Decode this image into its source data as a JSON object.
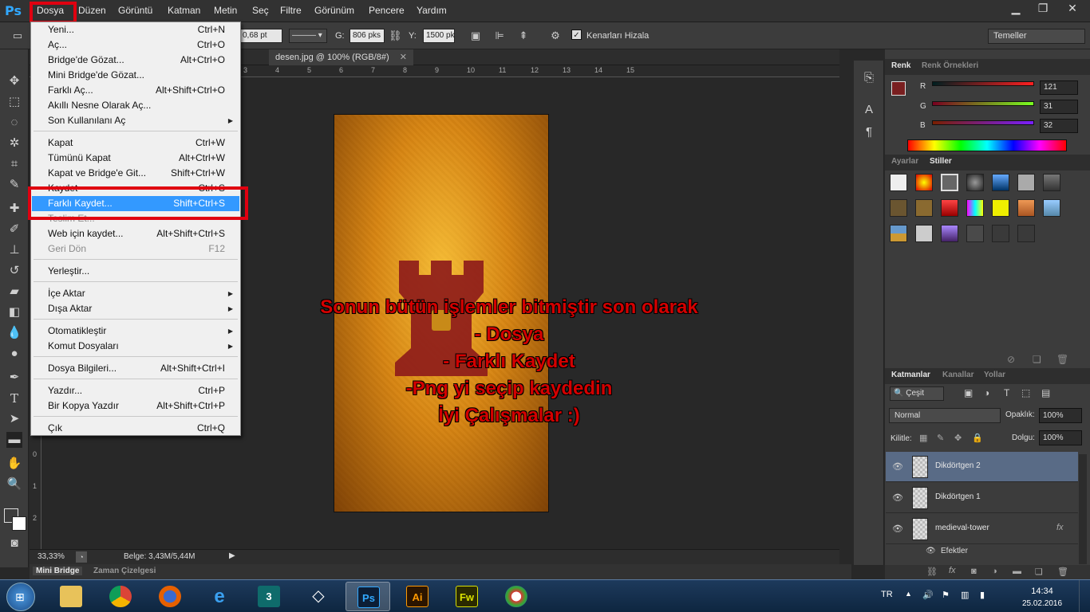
{
  "menubar": {
    "items": [
      "Dosya",
      "Düzen",
      "Görüntü",
      "Katman",
      "Metin",
      "Seç",
      "Filtre",
      "Görünüm",
      "Pencere",
      "Yardım"
    ],
    "logo": "Ps"
  },
  "options": {
    "stroke_size": "0,68 pt",
    "width_label": "G:",
    "width_value": "806 pks",
    "height_label": "Y:",
    "height_value": "1500 pk",
    "align_edges_label": "Kenarları Hizala",
    "align_edges_checked": true,
    "workspace": "Temeller"
  },
  "document": {
    "tab_title": "desen.jpg @ 100% (RGB/8#)",
    "zoom": "33,33%",
    "doc_info": "Belge: 3,43M/5,44M",
    "ruler_h_numbers": [
      "3",
      "4",
      "5",
      "6",
      "7",
      "8",
      "9",
      "10",
      "11",
      "12",
      "13",
      "14",
      "15"
    ],
    "ruler_v_numbers": [
      "0",
      "1",
      "2"
    ]
  },
  "annotation": {
    "lines": [
      "Sonun bütün işlemler bitmiştir son olarak",
      "- Dosya",
      "- Farklı Kaydet",
      "-Png yi seçip kaydedin",
      "İyi Çalışmalar :)"
    ],
    "color": "#d40000"
  },
  "dosya_menu": {
    "items": [
      {
        "label": "Yeni...",
        "shortcut": "Ctrl+N"
      },
      {
        "label": "Aç...",
        "shortcut": "Ctrl+O"
      },
      {
        "label": "Bridge'de Gözat...",
        "shortcut": "Alt+Ctrl+O"
      },
      {
        "label": "Mini Bridge'de Gözat...",
        "shortcut": ""
      },
      {
        "label": "Farklı Aç...",
        "shortcut": "Alt+Shift+Ctrl+O"
      },
      {
        "label": "Akıllı Nesne Olarak Aç...",
        "shortcut": ""
      },
      {
        "label": "Son Kullanılanı Aç",
        "shortcut": ""
      },
      {
        "label": "Kapat",
        "shortcut": "Ctrl+W"
      },
      {
        "label": "Tümünü Kapat",
        "shortcut": "Alt+Ctrl+W"
      },
      {
        "label": "Kapat ve Bridge'e Git...",
        "shortcut": "Shift+Ctrl+W"
      },
      {
        "label": "Kaydet",
        "shortcut": "Ctrl+S"
      },
      {
        "label": "Farklı Kaydet...",
        "shortcut": "Shift+Ctrl+S"
      },
      {
        "label": "Teslim Et...",
        "shortcut": ""
      },
      {
        "label": "Web için kaydet...",
        "shortcut": "Alt+Shift+Ctrl+S"
      },
      {
        "label": "Geri Dön",
        "shortcut": "F12"
      },
      {
        "label": "Yerleştir...",
        "shortcut": ""
      },
      {
        "label": "İçe Aktar",
        "shortcut": ""
      },
      {
        "label": "Dışa Aktar",
        "shortcut": ""
      },
      {
        "label": "Otomatikleştir",
        "shortcut": ""
      },
      {
        "label": "Komut Dosyaları",
        "shortcut": ""
      },
      {
        "label": "Dosya Bilgileri...",
        "shortcut": "Alt+Shift+Ctrl+I"
      },
      {
        "label": "Yazdır...",
        "shortcut": "Ctrl+P"
      },
      {
        "label": "Bir Kopya Yazdır",
        "shortcut": "Alt+Shift+Ctrl+P"
      },
      {
        "label": "Çık",
        "shortcut": "Ctrl+Q"
      }
    ],
    "highlighted": "Farklı Kaydet...",
    "highlight_color": "#3399ff"
  },
  "color_panel": {
    "tabs": [
      "Renk",
      "Renk Örnekleri"
    ],
    "r_label": "R",
    "g_label": "G",
    "b_label": "B",
    "r": "121",
    "g": "31",
    "b": "32",
    "foreground": "#791f20"
  },
  "styles_panel": {
    "tabs": [
      "Ayarlar",
      "Stiller"
    ]
  },
  "layers_panel": {
    "tabs": [
      "Katmanlar",
      "Kanallar",
      "Yollar"
    ],
    "filter": "Çeşit",
    "blend_mode": "Normal",
    "opacity_label": "Opaklık:",
    "opacity": "100%",
    "lock_label": "Kilitle:",
    "fill_label": "Dolgu:",
    "fill": "100%",
    "layers": [
      {
        "name": "Dikdörtgen 2",
        "selected": true
      },
      {
        "name": "Dikdörtgen 1",
        "selected": false
      },
      {
        "name": "medieval-tower",
        "selected": false
      }
    ],
    "effects_label": "Efektler",
    "fx_label": "fx"
  },
  "bottom_tabs": [
    "Mini Bridge",
    "Zaman Çizelgesi"
  ],
  "taskbar": {
    "lang": "TR",
    "time": "14:34",
    "date": "25.02.2016",
    "apps": [
      "Windows Gezgini",
      "Chrome",
      "Firefox",
      "Internet Explorer",
      "3ds Max",
      "Unity",
      "Photoshop",
      "Illustrator",
      "Fireworks",
      "Paint"
    ],
    "ai_label": "Ai",
    "fw_label": "Fw",
    "ps_label": "Ps"
  }
}
